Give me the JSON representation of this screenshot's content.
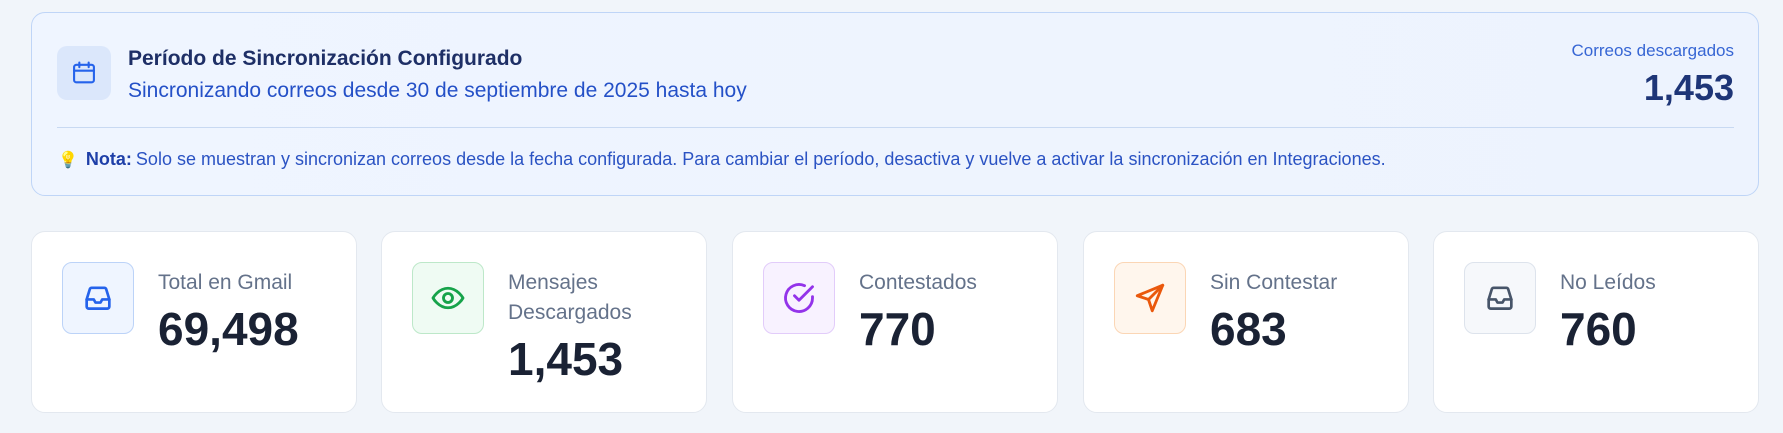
{
  "sync": {
    "title": "Período de Sincronización Configurado",
    "subtitle": "Sincronizando correos desde 30 de septiembre de 2025 hasta hoy",
    "downloaded_label": "Correos descargados",
    "downloaded_value": "1,453",
    "note_label": "Nota:",
    "note_text": "Solo se muestran y sincronizan correos desde la fecha configurada. Para cambiar el período, desactiva y vuelve a activar la sincronización en Integraciones.",
    "icon": "calendar-icon"
  },
  "stats": [
    {
      "label": "Total en Gmail",
      "value": "69,498",
      "icon": "inbox-icon",
      "color": "#2563eb"
    },
    {
      "label": "Mensajes Descargados",
      "value": "1,453",
      "icon": "eye-icon",
      "color": "#16a34a"
    },
    {
      "label": "Contestados",
      "value": "770",
      "icon": "check-circle-icon",
      "color": "#9333ea"
    },
    {
      "label": "Sin Contestar",
      "value": "683",
      "icon": "send-icon",
      "color": "#ea580c"
    },
    {
      "label": "No Leídos",
      "value": "760",
      "icon": "inbox-icon",
      "color": "#475569"
    }
  ]
}
